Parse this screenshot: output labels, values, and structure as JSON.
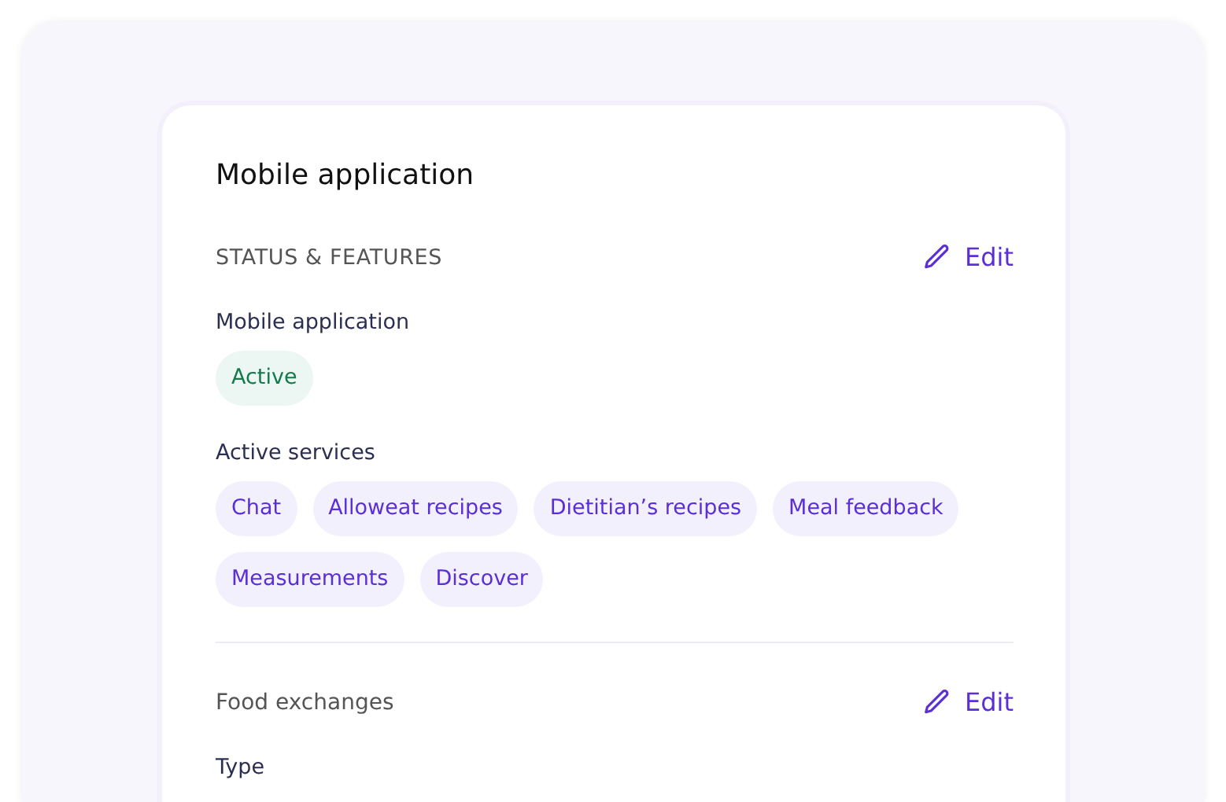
{
  "card": {
    "title": "Mobile application"
  },
  "sections": [
    {
      "heading": "STATUS & FEATURES",
      "kind": "caps",
      "edit": "Edit",
      "fields": [
        {
          "label": "Mobile application",
          "tags": [
            {
              "text": "Active",
              "kind": "success"
            }
          ]
        },
        {
          "label": "Active services",
          "tags": [
            {
              "text": "Chat",
              "kind": "service"
            },
            {
              "text": "Alloweat recipes",
              "kind": "service"
            },
            {
              "text": "Dietitian’s recipes",
              "kind": "service"
            },
            {
              "text": "Meal feedback",
              "kind": "service"
            },
            {
              "text": "Measurements",
              "kind": "service"
            },
            {
              "text": "Discover",
              "kind": "service"
            }
          ]
        }
      ]
    },
    {
      "heading": "Food exchanges",
      "kind": "plain",
      "edit": "Edit",
      "fields": [
        {
          "label": "Type"
        }
      ]
    }
  ]
}
